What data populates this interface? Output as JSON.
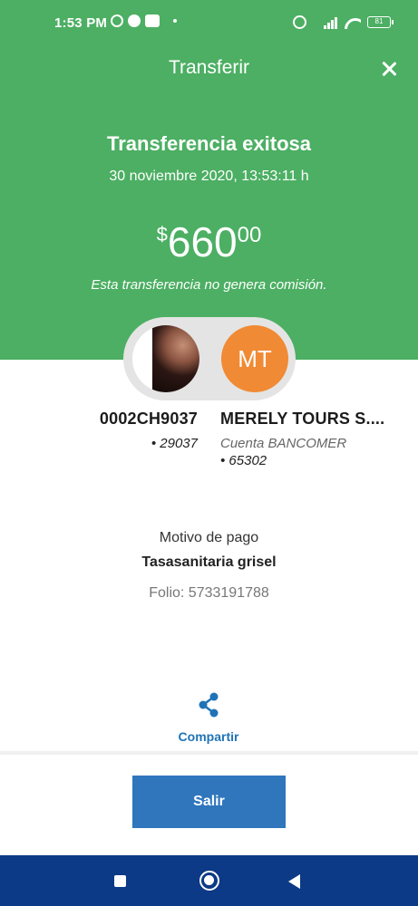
{
  "status_bar": {
    "time": "1:53 PM",
    "battery": "81",
    "icons": [
      "whatsapp-icon",
      "facebook-icon",
      "message-icon",
      "alarm-icon",
      "signal-icon",
      "wifi-icon",
      "battery-icon"
    ]
  },
  "header": {
    "title": "Transferir",
    "close_icon": "close-icon"
  },
  "result": {
    "title": "Transferencia exitosa",
    "date": "30 noviembre 2020, 13:53:11 h",
    "amount_currency": "$",
    "amount_integer": "660",
    "amount_decimals": "00",
    "commission_note": "Esta transferencia no genera comisión."
  },
  "origin": {
    "name": "0002CH9037",
    "account": "• 29037"
  },
  "destination": {
    "initials": "MT",
    "name": "MERELY TOURS S....",
    "bank": "Cuenta BANCOMER",
    "account": "• 65302"
  },
  "payment": {
    "reason_label": "Motivo de pago",
    "reason_value": "Tasasanitaria grisel",
    "folio": "Folio: 5733191788"
  },
  "share": {
    "label": "Compartir",
    "icon": "share-icon"
  },
  "exit_button": {
    "label": "Salir"
  },
  "colors": {
    "header_green": "#4caf63",
    "primary_blue": "#2f76bd",
    "avatar_orange": "#f08a34",
    "navbar_blue": "#0d3a86"
  }
}
